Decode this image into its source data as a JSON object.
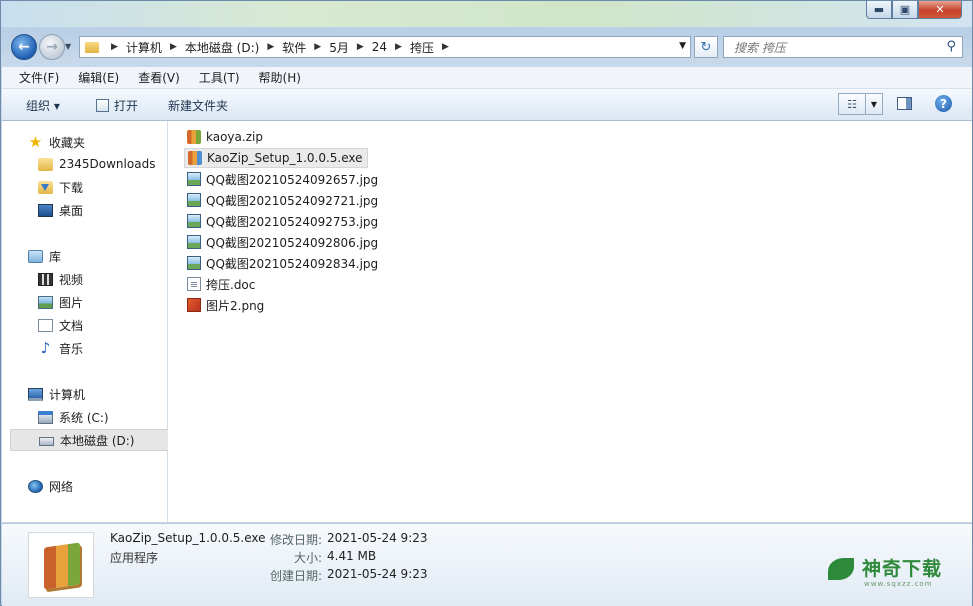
{
  "window": {
    "caption": {
      "minimize": "▬",
      "maximize": "▣",
      "close": "✕"
    }
  },
  "address": {
    "crumbs": [
      "计算机",
      "本地磁盘 (D:)",
      "软件",
      "5月",
      "24",
      "挎压"
    ],
    "search_placeholder": "搜索 挎压"
  },
  "menu": [
    "文件(F)",
    "编辑(E)",
    "查看(V)",
    "工具(T)",
    "帮助(H)"
  ],
  "commands": {
    "organize": "组织 ▾",
    "open": "打开",
    "new_folder": "新建文件夹"
  },
  "nav": {
    "favorites": "收藏夹",
    "fav_items": [
      "2345Downloads",
      "下载",
      "桌面"
    ],
    "libraries": "库",
    "lib_items": [
      "视频",
      "图片",
      "文档",
      "音乐"
    ],
    "computer": "计算机",
    "drives": [
      "系统 (C:)",
      "本地磁盘 (D:)"
    ],
    "network": "网络"
  },
  "files": [
    {
      "name": "kaoya.zip",
      "type": "zip"
    },
    {
      "name": "KaoZip_Setup_1.0.0.5.exe",
      "type": "exe"
    },
    {
      "name": "QQ截图20210524092657.jpg",
      "type": "jpg"
    },
    {
      "name": "QQ截图20210524092721.jpg",
      "type": "jpg"
    },
    {
      "name": "QQ截图20210524092753.jpg",
      "type": "jpg"
    },
    {
      "name": "QQ截图20210524092806.jpg",
      "type": "jpg"
    },
    {
      "name": "QQ截图20210524092834.jpg",
      "type": "jpg"
    },
    {
      "name": "挎压.doc",
      "type": "doc"
    },
    {
      "name": "图片2.png",
      "type": "png"
    }
  ],
  "selected_file": "KaoZip_Setup_1.0.0.5.exe",
  "details": {
    "name": "KaoZip_Setup_1.0.0.5.exe",
    "type": "应用程序",
    "modified_label": "修改日期:",
    "modified": "2021-05-24 9:23",
    "size_label": "大小:",
    "size": "4.41 MB",
    "created_label": "创建日期:",
    "created": "2021-05-24 9:23"
  },
  "watermark": {
    "text": "神奇下载",
    "url": "www.sqxzz.com"
  }
}
